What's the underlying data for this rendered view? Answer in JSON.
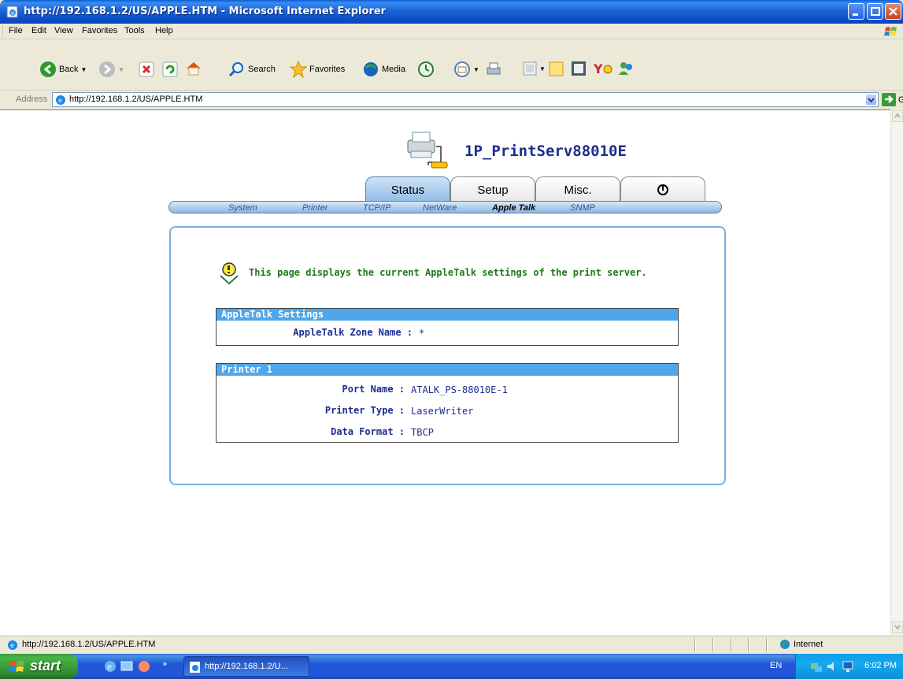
{
  "window": {
    "title": "http://192.168.1.2/US/APPLE.HTM - Microsoft Internet Explorer"
  },
  "menu": [
    "File",
    "Edit",
    "View",
    "Favorites",
    "Tools",
    "Help"
  ],
  "toolbar": {
    "back": "Back",
    "search": "Search",
    "favorites": "Favorites",
    "media": "Media"
  },
  "address": {
    "label": "Address",
    "url": "http://192.168.1.2/US/APPLE.HTM",
    "go": "Go"
  },
  "header": {
    "device_name": "1P_PrintServ88010E"
  },
  "tabs": [
    {
      "label": "Status",
      "active": true
    },
    {
      "label": "Setup",
      "active": false
    },
    {
      "label": "Misc.",
      "active": false
    }
  ],
  "subnav": [
    {
      "label": "System",
      "active": false
    },
    {
      "label": "Printer",
      "active": false
    },
    {
      "label": "TCP/IP",
      "active": false
    },
    {
      "label": "NetWare",
      "active": false
    },
    {
      "label": "Apple Talk",
      "active": true
    },
    {
      "label": "SNMP",
      "active": false
    }
  ],
  "content": {
    "info": "This page displays the current AppleTalk settings of the print server.",
    "appletalk": {
      "heading": "AppleTalk Settings",
      "zone_label": "AppleTalk Zone Name :",
      "zone_value": "*"
    },
    "printer": {
      "heading": "Printer 1",
      "port_label": "Port Name :",
      "port_value": "ATALK_PS-88010E-1",
      "type_label": "Printer Type :",
      "type_value": "LaserWriter",
      "format_label": "Data Format :",
      "format_value": "TBCP"
    }
  },
  "statusbar": {
    "text": "http://192.168.1.2/US/APPLE.HTM",
    "zone": "Internet"
  },
  "taskbar": {
    "start": "start",
    "task": "http://192.168.1.2/U...",
    "lang": "EN",
    "clock": "6:02 PM"
  },
  "colors": {
    "accent": "#4fa6ea",
    "title_bar": "#0a4fc8",
    "device_name": "#1d2d8f",
    "info_text": "#1c7a1c"
  }
}
